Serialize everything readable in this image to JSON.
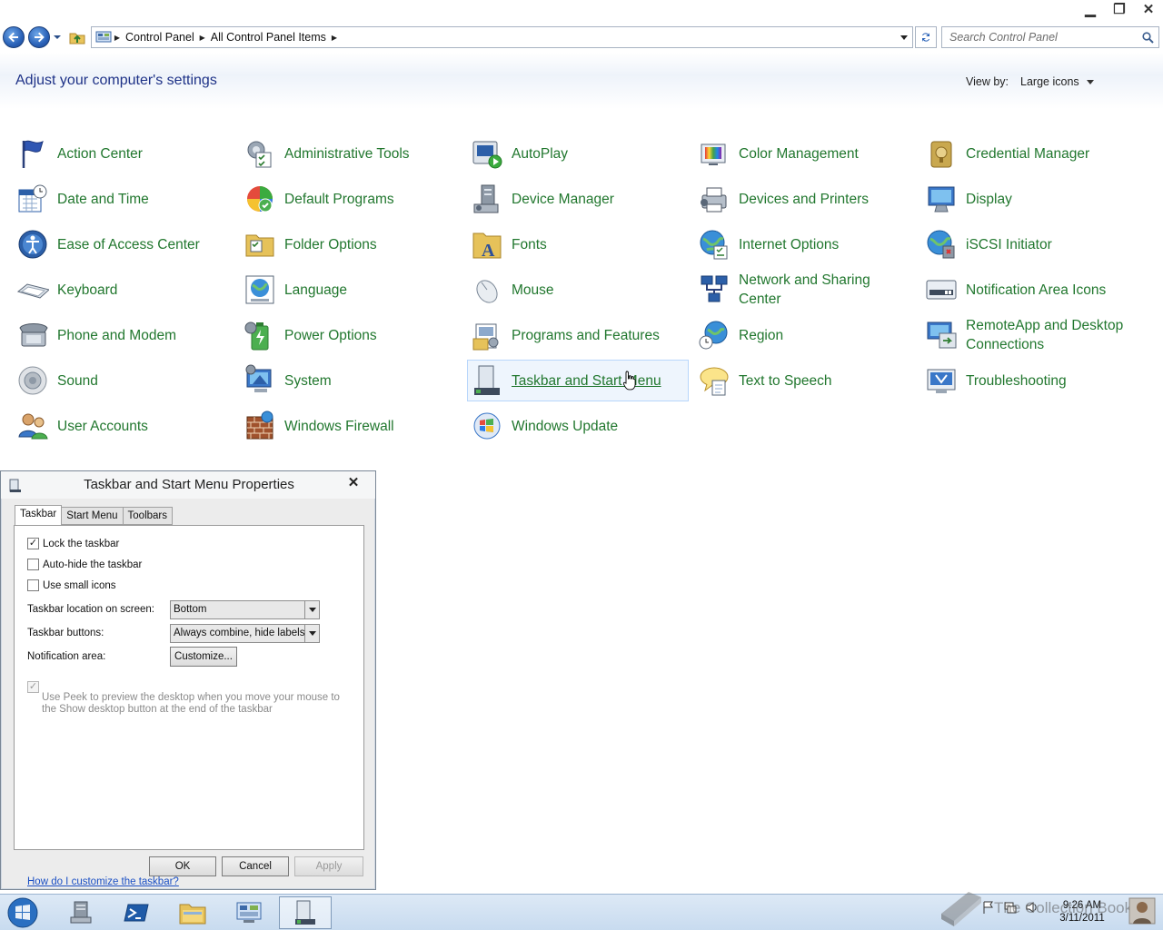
{
  "window": {
    "minimize_glyph": "▁",
    "restore_glyph": "❐",
    "close_glyph": "✕"
  },
  "address": {
    "crumbs": [
      "Control Panel",
      "All Control Panel Items"
    ],
    "search_placeholder": "Search Control Panel"
  },
  "header": {
    "title": "Adjust your computer's settings",
    "view_by_label": "View by:",
    "view_by_value": "Large icons"
  },
  "items": [
    {
      "label": "Action Center",
      "icon": "flag-icon",
      "line2": ""
    },
    {
      "label": "Administrative Tools",
      "icon": "admin-tools-icon",
      "line2": ""
    },
    {
      "label": "AutoPlay",
      "icon": "autoplay-icon",
      "line2": ""
    },
    {
      "label": "Color Management",
      "icon": "color-management-icon",
      "line2": ""
    },
    {
      "label": "Credential Manager",
      "icon": "credential-manager-icon",
      "line2": ""
    },
    {
      "label": "Date and Time",
      "icon": "calendar-clock-icon",
      "line2": ""
    },
    {
      "label": "Default Programs",
      "icon": "default-programs-icon",
      "line2": ""
    },
    {
      "label": "Device Manager",
      "icon": "device-manager-icon",
      "line2": ""
    },
    {
      "label": "Devices and Printers",
      "icon": "printer-icon",
      "line2": ""
    },
    {
      "label": "Display",
      "icon": "monitor-icon",
      "line2": ""
    },
    {
      "label": "Ease of Access Center",
      "icon": "ease-of-access-icon",
      "line2": ""
    },
    {
      "label": "Folder Options",
      "icon": "folder-options-icon",
      "line2": ""
    },
    {
      "label": "Fonts",
      "icon": "fonts-folder-icon",
      "line2": ""
    },
    {
      "label": "Internet Options",
      "icon": "internet-options-icon",
      "line2": ""
    },
    {
      "label": "iSCSI Initiator",
      "icon": "iscsi-icon",
      "line2": ""
    },
    {
      "label": "Keyboard",
      "icon": "keyboard-icon",
      "line2": ""
    },
    {
      "label": "Language",
      "icon": "language-icon",
      "line2": ""
    },
    {
      "label": "Mouse",
      "icon": "mouse-icon",
      "line2": ""
    },
    {
      "label": "Network and Sharing",
      "icon": "network-icon",
      "line2": "Center"
    },
    {
      "label": "Notification Area Icons",
      "icon": "notification-area-icon",
      "line2": ""
    },
    {
      "label": "Phone and Modem",
      "icon": "phone-icon",
      "line2": ""
    },
    {
      "label": "Power Options",
      "icon": "battery-icon",
      "line2": ""
    },
    {
      "label": "Programs and Features",
      "icon": "programs-icon",
      "line2": ""
    },
    {
      "label": "Region",
      "icon": "region-globe-icon",
      "line2": ""
    },
    {
      "label": "RemoteApp and Desktop",
      "icon": "remoteapp-icon",
      "line2": "Connections"
    },
    {
      "label": "Sound",
      "icon": "speaker-icon",
      "line2": ""
    },
    {
      "label": "System",
      "icon": "system-icon",
      "line2": ""
    },
    {
      "label": "Taskbar and Start Menu",
      "icon": "taskbar-icon",
      "line2": ""
    },
    {
      "label": "Text to Speech",
      "icon": "speech-bubble-icon",
      "line2": ""
    },
    {
      "label": "Troubleshooting",
      "icon": "troubleshooting-icon",
      "line2": ""
    },
    {
      "label": "User Accounts",
      "icon": "users-icon",
      "line2": ""
    },
    {
      "label": "Windows Firewall",
      "icon": "firewall-icon",
      "line2": ""
    },
    {
      "label": "Windows Update",
      "icon": "windows-update-icon",
      "line2": ""
    }
  ],
  "hovered_item": "Taskbar and Start Menu",
  "dialog": {
    "title": "Taskbar and Start Menu Properties",
    "tabs": [
      "Taskbar",
      "Start Menu",
      "Toolbars"
    ],
    "active_tab": "Taskbar",
    "lock_taskbar": "Lock the taskbar",
    "lock_taskbar_checked": true,
    "auto_hide": "Auto-hide the taskbar",
    "auto_hide_checked": false,
    "small_icons": "Use small icons",
    "small_icons_checked": false,
    "location_label": "Taskbar location on screen:",
    "location_value": "Bottom",
    "buttons_label": "Taskbar buttons:",
    "buttons_value": "Always combine, hide labels",
    "notification_label": "Notification area:",
    "customize_button": "Customize...",
    "peek_text": "Use Peek to preview the desktop when you move your mouse to the Show desktop button at the end of the taskbar",
    "peek_checked": true,
    "help_link": "How do I customize the taskbar?",
    "ok": "OK",
    "cancel": "Cancel",
    "apply": "Apply"
  },
  "taskbar": {
    "pinned": [
      "server-manager-icon",
      "powershell-icon",
      "explorer-folder-icon",
      "control-panel-icon",
      "taskbar-properties-icon"
    ],
    "active_index": 4,
    "time": "9:26 AM",
    "date": "3/11/2011"
  },
  "watermark": "The Collection Book",
  "colors": {
    "link_green": "#21772e",
    "title_blue": "#1e3287",
    "hover_bg": "#eef5fd",
    "hover_border": "#b8d6fb"
  }
}
